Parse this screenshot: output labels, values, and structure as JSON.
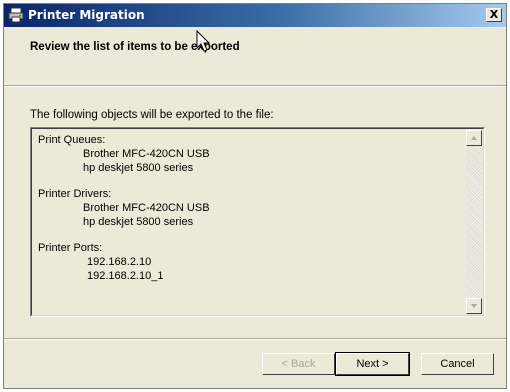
{
  "window": {
    "title": "Printer Migration",
    "close_label": "X"
  },
  "header": {
    "title": "Review the list of items to be exported"
  },
  "body": {
    "intro": "The following objects will be exported to the file:",
    "sections": [
      {
        "heading": "Print Queues:",
        "items": [
          "Brother MFC-420CN USB",
          "hp deskjet 5800 series"
        ]
      },
      {
        "heading": "Printer Drivers:",
        "items": [
          "Brother MFC-420CN USB",
          "hp deskjet 5800 series"
        ]
      },
      {
        "heading": "Printer Ports:",
        "items": [
          "192.168.2.10",
          "192.168.2.10_1"
        ]
      }
    ]
  },
  "buttons": {
    "back": "< Back",
    "next": "Next >",
    "cancel": "Cancel"
  },
  "colors": {
    "titlebar_start": "#0a246a",
    "titlebar_end": "#a6caf0",
    "face": "#ece9d8",
    "disabled_text": "#aca899"
  },
  "icons": {
    "app": "printer-icon",
    "close": "close-icon",
    "scroll_up": "scroll-up-arrow-icon",
    "scroll_down": "scroll-down-arrow-icon",
    "cursor": "mouse-pointer-icon"
  }
}
